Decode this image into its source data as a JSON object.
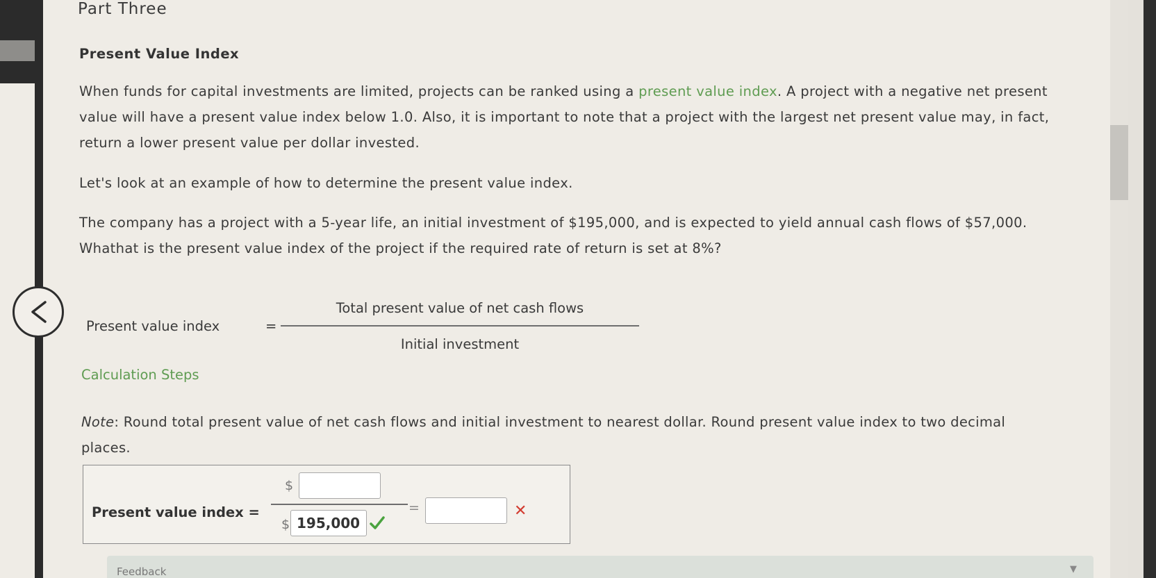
{
  "page": {
    "part_title": "Part Three",
    "section_title": "Present Value Index",
    "intro": {
      "before_link": "When funds for capital investments are limited, projects can be ranked using a ",
      "link": "present value index",
      "after_link_line1": ". A project with a negative net present",
      "line2": "value will have a present value index below 1.0. Also, it is important to note that a project with the largest net present value may, in fact,",
      "line3": "return a lower present value per dollar invested."
    },
    "example_intro": "Let's look at an example of how to determine the present value index.",
    "problem": {
      "line1": "The company has a project with a 5-year life, an initial investment of $195,000, and is expected to yield annual cash flows of $57,000.",
      "line2": "Whathat is the present value index of the project if the required rate of return is set at 8%?"
    },
    "formula": {
      "label": "Present value index",
      "equals": "=",
      "numerator": "Total present value of net cash flows",
      "denominator": "Initial investment"
    },
    "calculation_steps_link": "Calculation Steps",
    "note": {
      "prefix": "Note",
      "line1": ": Round total present value of net cash flows and initial investment to nearest dollar. Round present value index to two decimal",
      "line2": "places."
    },
    "answer": {
      "label": "Present value index =",
      "numerator_currency": "$",
      "numerator_value": "",
      "denominator_currency": "$",
      "denominator_value": "195,000",
      "equals": "=",
      "result_value": "",
      "denominator_status": "correct",
      "result_status": "incorrect"
    },
    "feedback_label": "Feedback"
  },
  "colors": {
    "link_green": "#5f9c52",
    "check_green": "#4aa33f",
    "error_red": "#d23b2f"
  },
  "icons": [
    "back-chevron-icon",
    "checkmark-icon",
    "x-mark-icon",
    "dropdown-triangle-icon"
  ]
}
